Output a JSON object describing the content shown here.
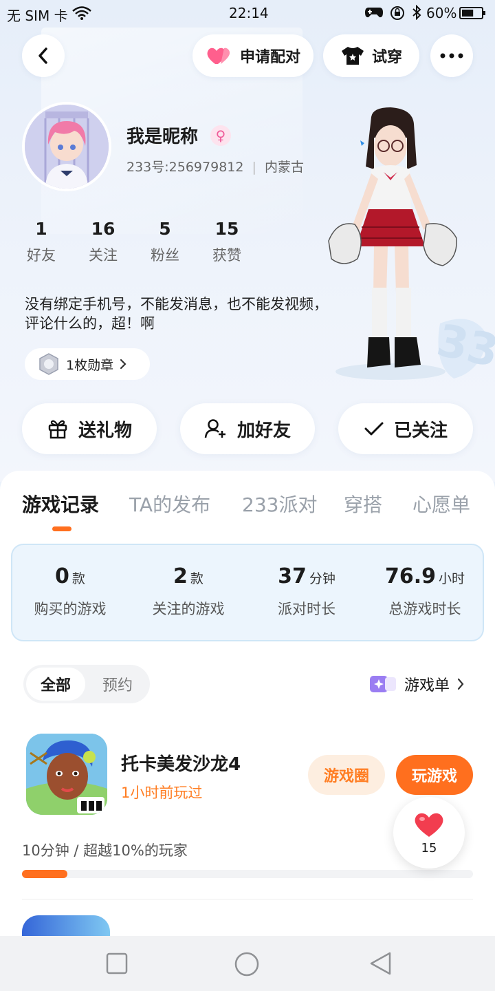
{
  "status": {
    "carrier": "无 SIM 卡",
    "time": "22:14",
    "battery": "60%",
    "battery_level": 0.6
  },
  "header": {
    "match_label": "申请配对",
    "tryon_label": "试穿"
  },
  "profile": {
    "nickname": "我是昵称",
    "uid": "233号:256979812",
    "region": "内蒙古",
    "stats": [
      {
        "value": "1",
        "label": "好友"
      },
      {
        "value": "16",
        "label": "关注"
      },
      {
        "value": "5",
        "label": "粉丝"
      },
      {
        "value": "15",
        "label": "获赞"
      }
    ],
    "bio": "没有绑定手机号，不能发消息，也不能发视频，评论什么的，超！啊",
    "medal_label": "1枚勋章"
  },
  "actions": {
    "gift": "送礼物",
    "add_friend": "加好友",
    "followed": "已关注"
  },
  "tabs": [
    "游戏记录",
    "TA的发布",
    "233派对",
    "穿搭",
    "心愿单"
  ],
  "summary": [
    {
      "value": "0",
      "unit": "款",
      "label": "购买的游戏"
    },
    {
      "value": "2",
      "unit": "款",
      "label": "关注的游戏"
    },
    {
      "value": "37",
      "unit": "分钟",
      "label": "派对时长"
    },
    {
      "value": "76.9",
      "unit": "小时",
      "label": "总游戏时长"
    }
  ],
  "filter": {
    "all": "全部",
    "reserve": "预约",
    "game_list": "游戏单"
  },
  "game": {
    "name": "托卡美发沙龙4",
    "last_played": "1小时前玩过",
    "circle_label": "游戏圈",
    "play_label": "玩游戏",
    "progress_text": "10分钟 / 超越10%的玩家",
    "progress": 0.1
  },
  "like_count": "15",
  "colors": {
    "accent": "#ff6f1e",
    "pink": "#ef5c9a"
  }
}
